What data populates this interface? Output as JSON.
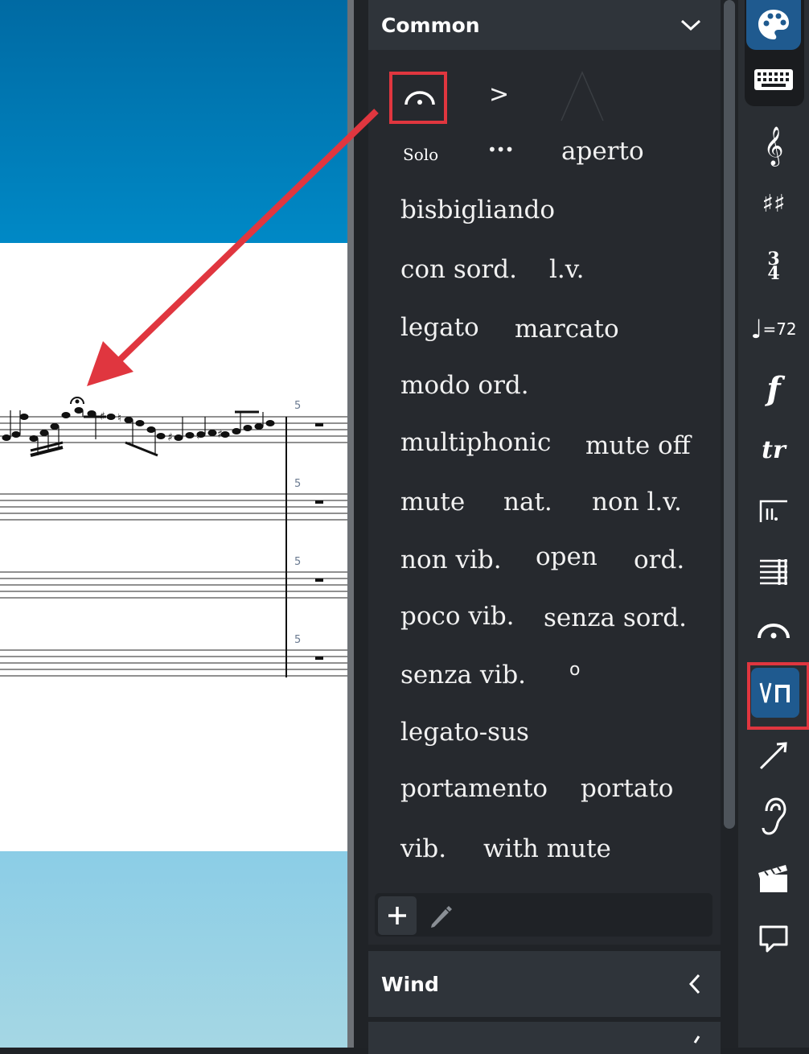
{
  "panel": {
    "common": {
      "title": "Common",
      "symbols": {
        "accent": ">",
        "more": "•••",
        "harmonic": "o"
      },
      "solo_label": "Solo",
      "techniques": {
        "aperto": "aperto",
        "bisbigliando": "bisbigliando",
        "con_sord": "con sord.",
        "lv": "l.v.",
        "legato": "legato",
        "marcato": "marcato",
        "modo_ord": "modo ord.",
        "multiphonic": "multiphonic",
        "mute_off": "mute off",
        "mute": "mute",
        "nat": "nat.",
        "non_lv": "non l.v.",
        "non_vib": "non vib.",
        "open": "open",
        "ord": "ord.",
        "poco_vib": "poco vib.",
        "senza_sord": "senza sord.",
        "senza_vib": "senza vib.",
        "legato_sus": "legato-sus",
        "portamento": "portamento",
        "portato": "portato",
        "vib": "vib.",
        "with_mute": "with mute"
      }
    },
    "wind": {
      "title": "Wind"
    }
  },
  "score": {
    "bar_number": "5"
  },
  "toolbar": {
    "tempo_text": "=72",
    "time_sig_top": "3",
    "time_sig_bottom": "4"
  },
  "colors": {
    "accent": "#e0363f",
    "selected": "#1f5a8f",
    "panel": "#26292e"
  }
}
